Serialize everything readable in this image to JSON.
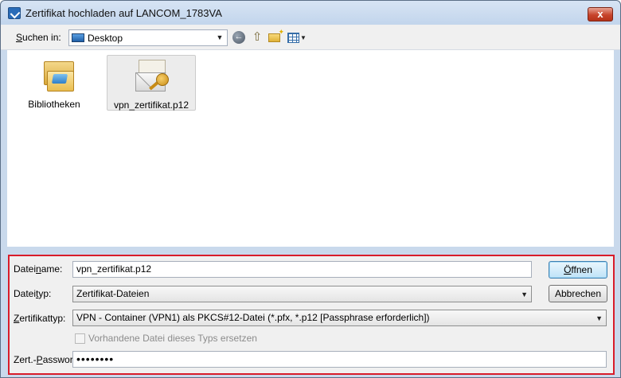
{
  "window": {
    "title": "Zertifikat hochladen auf LANCOM_1783VA",
    "close_glyph": "x"
  },
  "toolbar": {
    "lookin_label_pre": "S",
    "lookin_label_post": "uchen in:",
    "lookin_value": "Desktop",
    "back_glyph": "←",
    "up_glyph": "⇧"
  },
  "files": [
    {
      "name": "Bibliotheken",
      "icon": "library-folder-icon"
    },
    {
      "name": "vpn_zertifikat.p12",
      "icon": "certificate-envelope-icon"
    }
  ],
  "form": {
    "filename": {
      "label_pre": "Datei",
      "label_u": "n",
      "label_post": "ame:",
      "value": "vpn_zertifikat.p12"
    },
    "filetype": {
      "label_pre": "Datei",
      "label_u": "t",
      "label_post": "yp:",
      "value": "Zertifikat-Dateien"
    },
    "certtype": {
      "label_pre": "",
      "label_u": "Z",
      "label_post": "ertifikattyp:",
      "value": "VPN - Container (VPN1) als PKCS#12-Datei (*.pfx, *.p12 [Passphrase erforderlich])"
    },
    "replace_checkbox_label": "Vorhandene Datei dieses Typs ersetzen",
    "password": {
      "label_pre": "Zert.-",
      "label_u": "P",
      "label_post": "asswort:",
      "value": "••••••••"
    },
    "open_button_pre": "",
    "open_button_u": "Ö",
    "open_button_post": "ffnen",
    "cancel_button": "Abbrechen"
  }
}
